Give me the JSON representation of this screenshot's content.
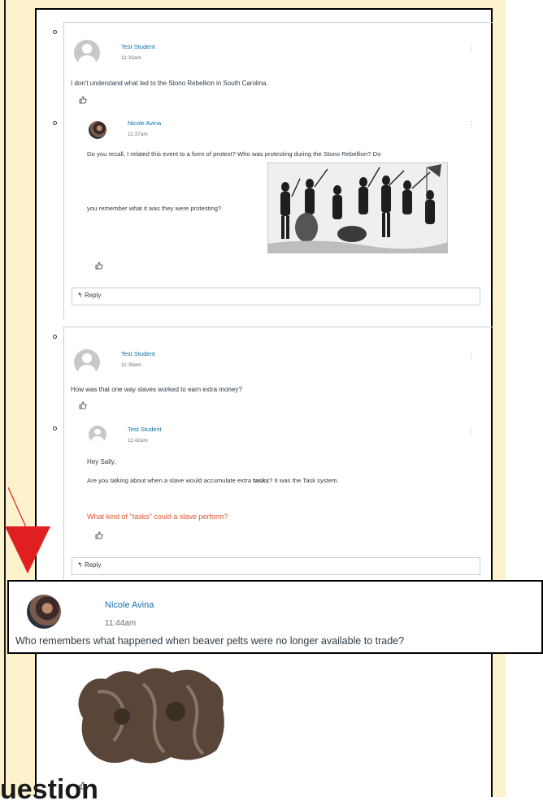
{
  "colors": {
    "accent_link": "#0770a3",
    "highlight_red": "#e0552f",
    "cream_background": "#fdf2cc",
    "annotation_arrow": "#e02020"
  },
  "thread1": {
    "post": {
      "author": "Test Student",
      "time": "11:33am",
      "body": "I don't understand what led to the Stono Rebellion in South Carolina."
    },
    "reply": {
      "author": "Nicole Avina",
      "time": "11:37am",
      "body_line1": "Do you recall, I related this event to a form of protest? Who was protesting during the Stono Rebellion? Do",
      "body_line2": "you remember what it was they were protesting?"
    },
    "reply_label": "Reply"
  },
  "thread2": {
    "post": {
      "author": "Test Student",
      "time": "11:39am",
      "body": "How was that one way slaves worked to earn extra money?"
    },
    "reply": {
      "author": "Test Student",
      "time": "11:42am",
      "line1": "Hey Sally,",
      "line2_prefix": "Are you talking about when a slave would accumulate extra ",
      "line2_bold": "tasks",
      "line2_suffix": "? It was the Task system.",
      "question": "What kind of \"tasks\" could a slave perform?"
    },
    "reply_label": "Reply"
  },
  "callout": {
    "author": "Nicole Avina",
    "time": "11:44am",
    "body": "Who remembers what happened when beaver pelts were no longer available to trade?"
  },
  "icons": {
    "like": "thumbs-up-icon",
    "menu": "kebab-menu-icon",
    "reply": "reply-arrow-icon",
    "bullet": "list-bullet-icon"
  },
  "bottom_heading_fragment": "uestion"
}
